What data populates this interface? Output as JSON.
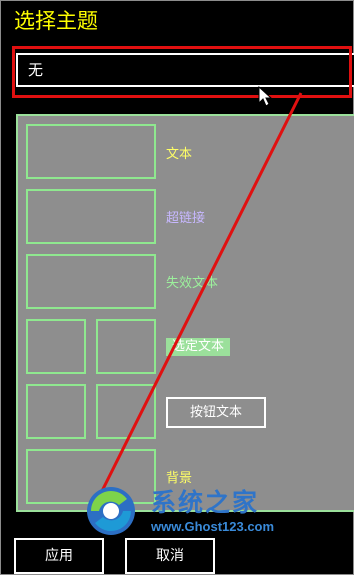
{
  "dialog": {
    "title": "选择主题"
  },
  "theme_select": {
    "selected": "无"
  },
  "preview": {
    "text_label": "文本",
    "hyperlink_label": "超链接",
    "disabled_text_label": "失效文本",
    "selected_text_label": "选定文本",
    "button_text_label": "按钮文本",
    "background_label": "背景"
  },
  "actions": {
    "apply_label": "应用",
    "cancel_label": "取消"
  },
  "watermark": {
    "brand": "系统之家",
    "url": "www.Ghost123.com"
  },
  "colors": {
    "title": "#ffff00",
    "panel_bg": "#8e8e8e",
    "swatch_border": "#8fe88f",
    "text_color": "#ffff66",
    "hyperlink_color": "#c7b8ff",
    "disabled_text_color": "#9cf09c",
    "selected_text_bg": "#9be09b",
    "highlight": "#e01010"
  }
}
